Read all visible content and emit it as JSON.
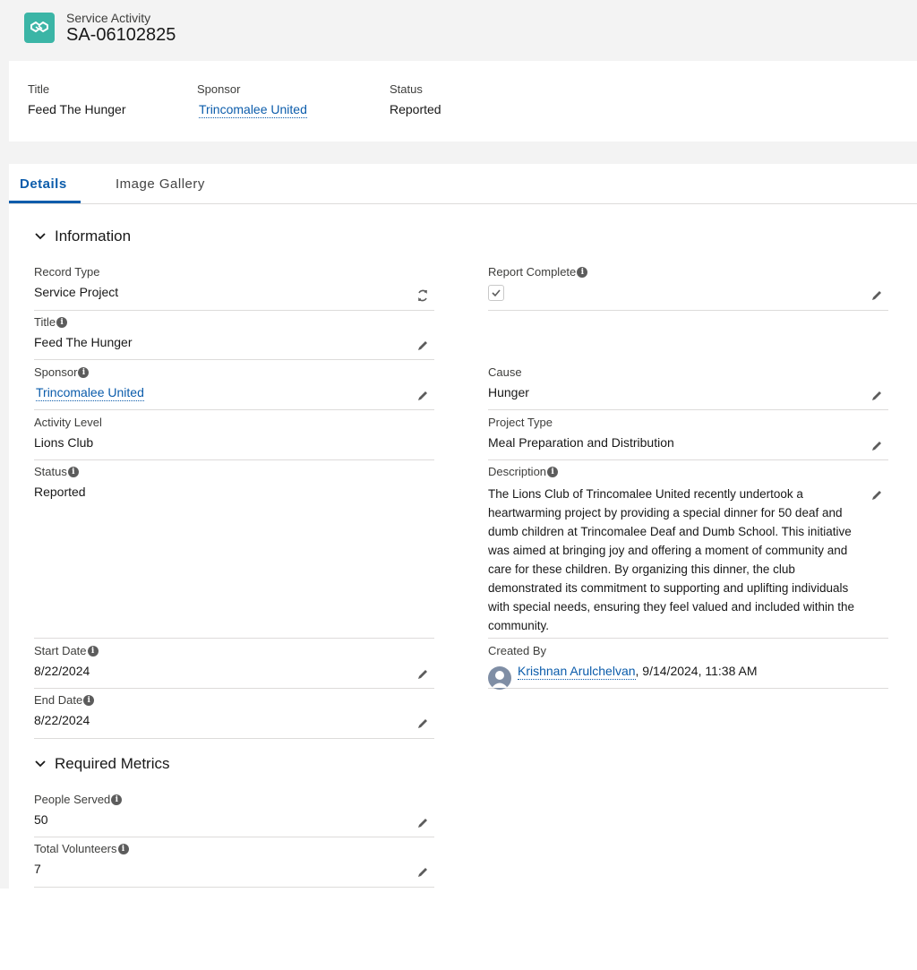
{
  "header": {
    "object_type": "Service Activity",
    "record_name": "SA-06102825",
    "icon": "handshake-icon",
    "icon_color": "#3bb5a6"
  },
  "highlights": {
    "title_label": "Title",
    "title_value": "Feed The Hunger",
    "sponsor_label": "Sponsor",
    "sponsor_value": "Trincomalee United",
    "status_label": "Status",
    "status_value": "Reported"
  },
  "tabs": {
    "details": "Details",
    "gallery": "Image Gallery"
  },
  "sections": {
    "information": "Information",
    "required_metrics": "Required Metrics"
  },
  "fields": {
    "record_type": {
      "label": "Record Type",
      "value": "Service Project"
    },
    "report_complete": {
      "label": "Report Complete",
      "checked": true
    },
    "title": {
      "label": "Title",
      "value": "Feed The Hunger"
    },
    "sponsor": {
      "label": "Sponsor",
      "value": "Trincomalee United"
    },
    "cause": {
      "label": "Cause",
      "value": "Hunger"
    },
    "activity_level": {
      "label": "Activity Level",
      "value": "Lions Club"
    },
    "project_type": {
      "label": "Project Type",
      "value": "Meal Preparation and Distribution"
    },
    "status": {
      "label": "Status",
      "value": "Reported"
    },
    "description": {
      "label": "Description",
      "value": "The Lions Club of Trincomalee United recently undertook a heartwarming project by providing a special dinner for 50 deaf and dumb children at Trincomalee Deaf and Dumb School. This initiative was aimed at bringing joy and offering a moment of community and care for these children. By organizing this dinner, the club demonstrated its commitment to supporting and uplifting individuals with special needs, ensuring they feel valued and included within the community."
    },
    "start_date": {
      "label": "Start Date",
      "value": "8/22/2024"
    },
    "created_by": {
      "label": "Created By",
      "user": "Krishnan Arulchelvan",
      "timestamp": ", 9/14/2024, 11:38 AM"
    },
    "end_date": {
      "label": "End Date",
      "value": "8/22/2024"
    },
    "people_served": {
      "label": "People Served",
      "value": "50"
    },
    "total_volunteers": {
      "label": "Total Volunteers",
      "value": "7"
    }
  },
  "colors": {
    "link": "#0b5cab",
    "page_bg": "#f3f3f3",
    "divider": "#dddbda"
  }
}
